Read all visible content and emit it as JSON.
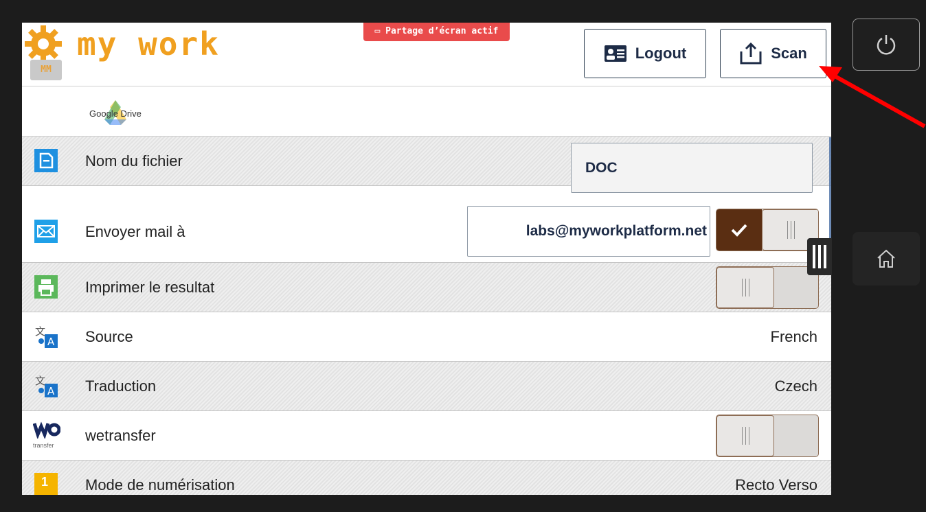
{
  "header": {
    "logo_text": "my work",
    "logo_badge_text": "MM",
    "share_banner": "Partage d’écran actif",
    "logout_label": "Logout",
    "scan_label": "Scan"
  },
  "destination": {
    "label": "Google Drive"
  },
  "rows": [
    {
      "label": "Nom du fichier",
      "icon": "file-icon",
      "field_value": "DOC"
    },
    {
      "label": "Envoyer mail à",
      "icon": "mail-icon",
      "field_value": "labs@myworkplatform.net",
      "toggle_on": true
    },
    {
      "label": "Imprimer le resultat",
      "icon": "printer-icon",
      "toggle_on": false
    },
    {
      "label": "Source",
      "icon": "translate-icon",
      "value": "French"
    },
    {
      "label": "Traduction",
      "icon": "translate-icon",
      "value": "Czech"
    },
    {
      "label": "wetransfer",
      "icon": "wetransfer-icon",
      "icon_text": "transfer",
      "toggle_on": false
    },
    {
      "label": "Mode de numérisation",
      "icon": "scan-mode-icon",
      "icon_text": "1",
      "value": "Recto Verso"
    }
  ],
  "colors": {
    "accent_orange": "#f0a020",
    "toggle_on": "#5a2e12",
    "banner_red": "#e94b4b",
    "arrow_red": "#ff0000"
  }
}
